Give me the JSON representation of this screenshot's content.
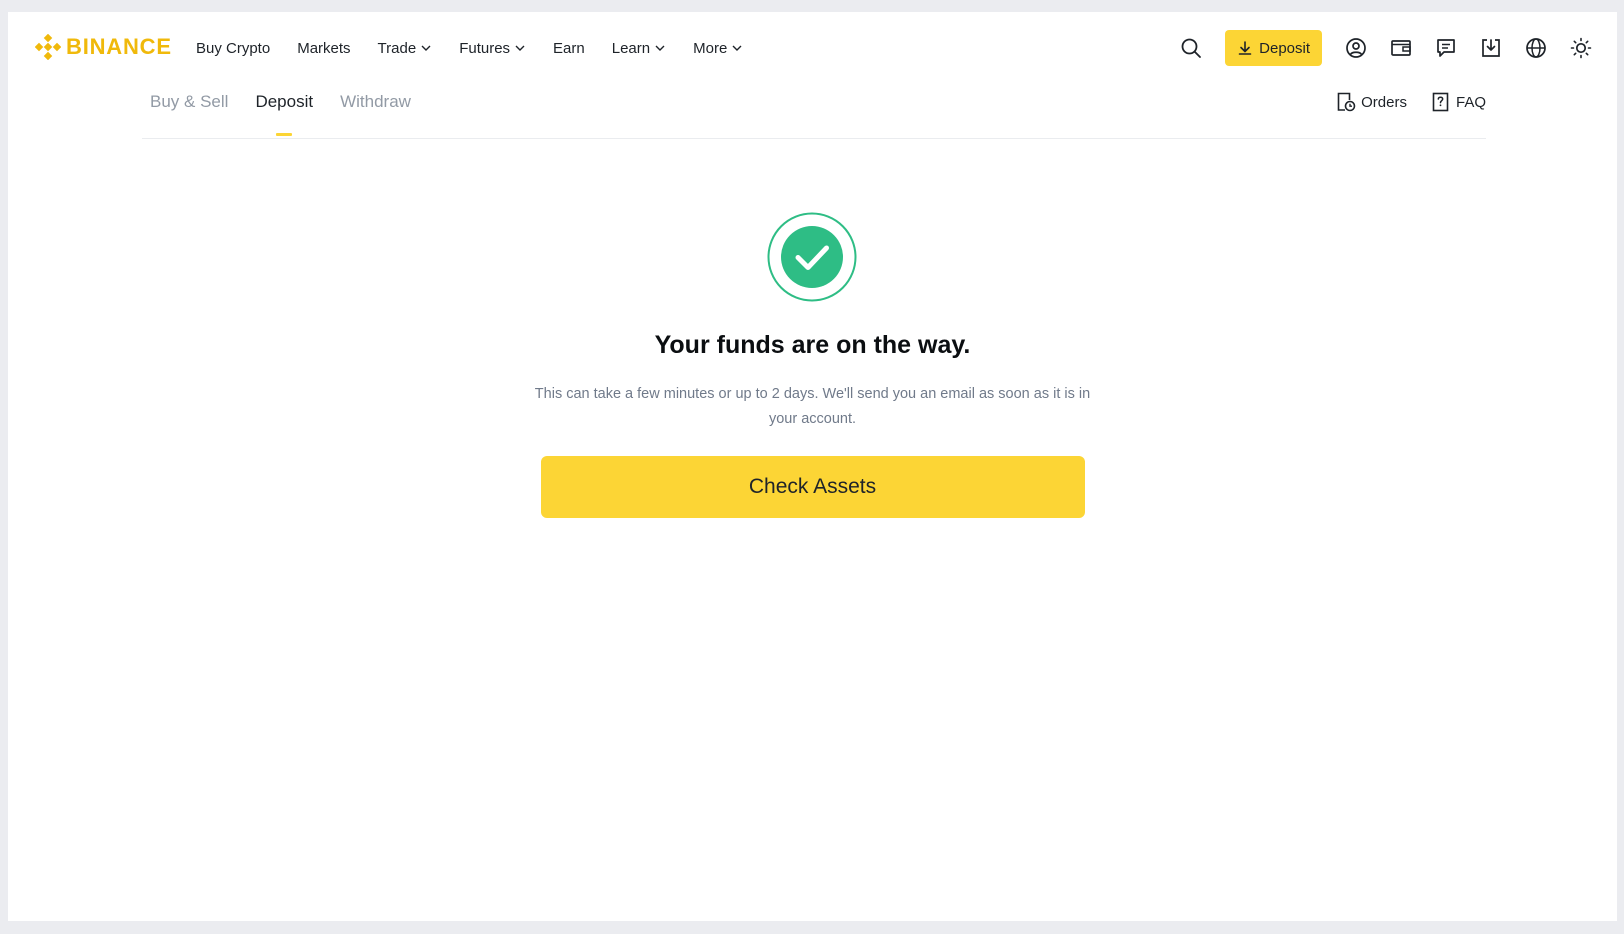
{
  "brand": {
    "name": "BINANCE",
    "color": "#f0b90b"
  },
  "nav": {
    "items": [
      {
        "label": "Buy Crypto",
        "dropdown": false
      },
      {
        "label": "Markets",
        "dropdown": false
      },
      {
        "label": "Trade",
        "dropdown": true
      },
      {
        "label": "Futures",
        "dropdown": true
      },
      {
        "label": "Earn",
        "dropdown": false
      },
      {
        "label": "Learn",
        "dropdown": true
      },
      {
        "label": "More",
        "dropdown": true
      }
    ],
    "deposit_label": "Deposit",
    "icons": [
      "search-icon",
      "account-icon",
      "wallet-icon",
      "messages-icon",
      "download-icon",
      "language-icon",
      "theme-icon"
    ]
  },
  "subnav": {
    "tabs": [
      "Buy & Sell",
      "Deposit",
      "Withdraw"
    ],
    "active_tab": "Deposit",
    "orders_label": "Orders",
    "faq_label": "FAQ"
  },
  "status": {
    "icon": "check-circle-icon",
    "title": "Your funds are on the way.",
    "description": "This can take a few minutes or up to 2 days. We'll send you an email as soon as it is in your account.",
    "button_label": "Check Assets"
  },
  "colors": {
    "accent": "#fcd535",
    "success": "#2ebd85",
    "text_primary": "#1e2329",
    "text_secondary": "#707a8a",
    "tab_inactive": "#929aa5"
  }
}
